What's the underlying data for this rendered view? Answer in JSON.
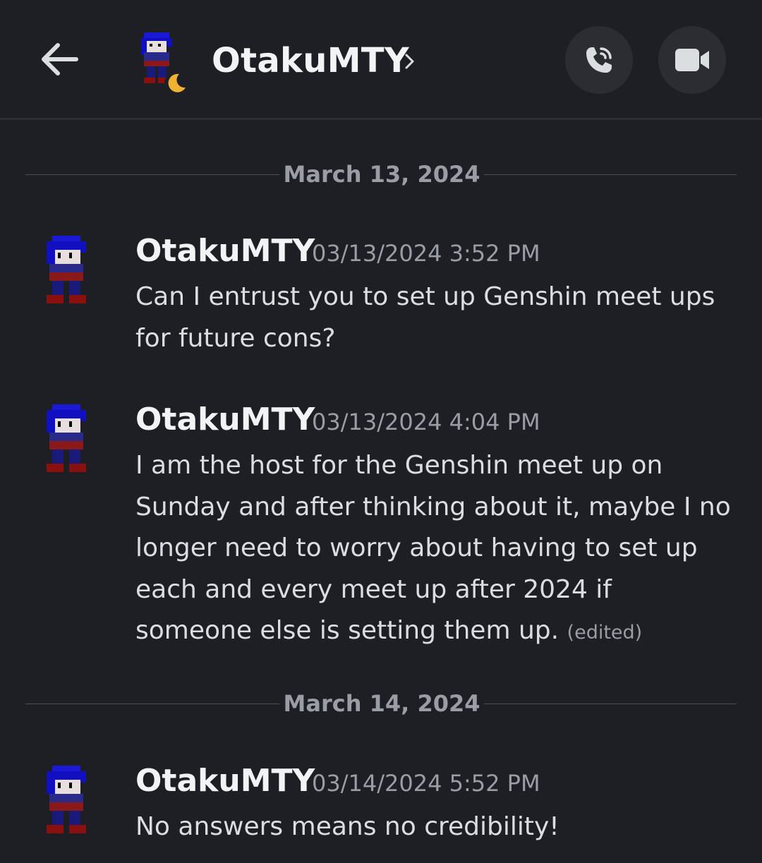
{
  "header": {
    "title": "OtakuMTY",
    "back_icon": "arrow-left-icon",
    "call_icon": "phone-call-icon",
    "video_icon": "video-camera-icon",
    "status": "idle-moon-icon"
  },
  "dividers": [
    {
      "label": "March 13, 2024"
    },
    {
      "label": "March 14, 2024"
    }
  ],
  "messages": [
    {
      "author": "OtakuMTY",
      "timestamp": "03/13/2024 3:52 PM",
      "text": "Can I entrust you to set up Genshin meet ups for future cons?",
      "edited": ""
    },
    {
      "author": "OtakuMTY",
      "timestamp": "03/13/2024 4:04 PM",
      "text": "I am the host for the Genshin meet up on Sunday and after thinking about it, maybe I no longer need to worry about having to set up each and every meet up after 2024 if someone else is setting them up.",
      "edited": "(edited)"
    },
    {
      "author": "OtakuMTY",
      "timestamp": "03/14/2024 5:52 PM",
      "text": "No answers means no credibility!",
      "edited": ""
    }
  ],
  "colors": {
    "background": "#1e1f24",
    "button_bg": "#2b2d33",
    "text_primary": "#f2f3f5",
    "text_muted": "#9a9ca6",
    "status_idle": "#f0b232"
  }
}
